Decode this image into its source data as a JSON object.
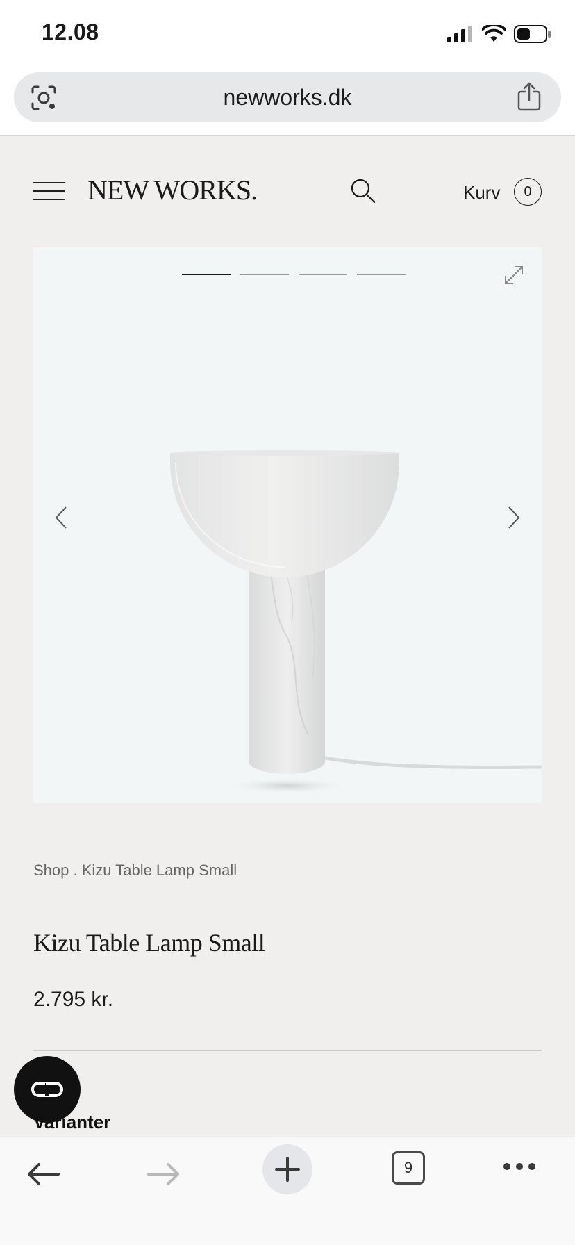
{
  "status_bar": {
    "time": "12.08"
  },
  "browser": {
    "url": "newworks.dk",
    "tab_count": "9"
  },
  "site": {
    "brand": "NEW WORKS.",
    "cart_label": "Kurv",
    "cart_count": "0"
  },
  "gallery": {
    "slide_count": 4,
    "active_slide": 1
  },
  "product": {
    "breadcrumb": "Shop . Kizu Table Lamp Small",
    "title": "Kizu Table Lamp Small",
    "price": "2.795 kr.",
    "variants_heading": "Varianter"
  },
  "icons": {
    "lens": "visual-search-icon",
    "share": "share-icon",
    "menu": "hamburger-menu-icon",
    "search": "search-icon",
    "expand": "expand-icon",
    "chat": "chat-icon"
  }
}
